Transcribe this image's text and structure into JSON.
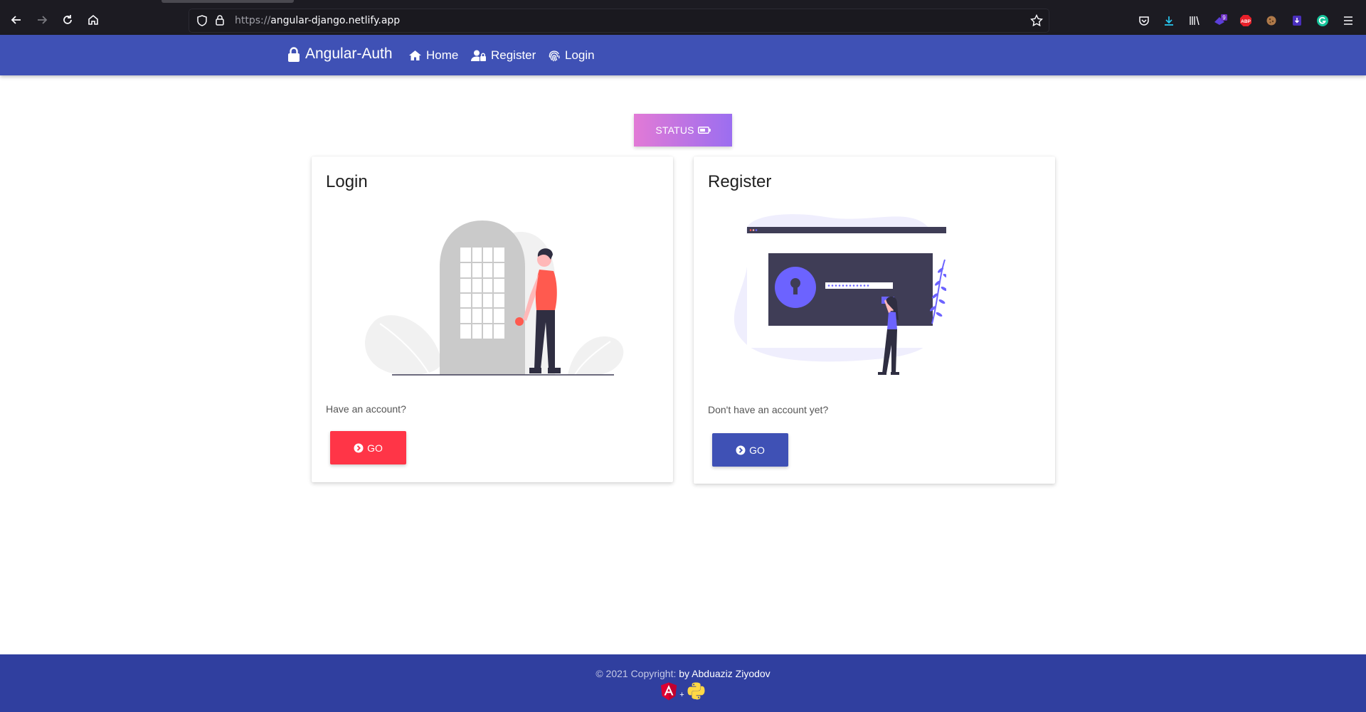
{
  "browser": {
    "url_protocol": "https://",
    "url_host": "angular-django.netlify.app",
    "extension_badge": "9",
    "abp_label": "ABP"
  },
  "navbar": {
    "brand": "Angular-Auth",
    "items": [
      {
        "label": "Home"
      },
      {
        "label": "Register"
      },
      {
        "label": "Login"
      }
    ]
  },
  "status_button": {
    "label": "STATUS"
  },
  "cards": {
    "login": {
      "title": "Login",
      "text": "Have an account?",
      "button": "GO"
    },
    "register": {
      "title": "Register",
      "text": "Don't have an account yet?",
      "button": "GO"
    }
  },
  "footer": {
    "copyright": "© 2021 Copyright:",
    "author": "by Abduaziz Ziyodov",
    "plus": "+"
  },
  "colors": {
    "primary": "#3f51b5",
    "footer": "#303f9f",
    "danger": "#ff3547",
    "illustration_accent": "#6c63ff",
    "login_person": "#ff5a4f"
  }
}
